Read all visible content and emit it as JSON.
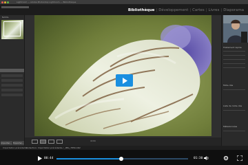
{
  "window": {
    "title": "Lightroom — Adobe Photoshop Lightroom — Bibliothèque"
  },
  "modules": [
    "Bibliothèque",
    "Développement",
    "Cartes",
    "Livres",
    "Diaporama"
  ],
  "active_module": "Bibliothèque",
  "left_panel": {
    "navigator_label": "NAVIG.",
    "import_button": "Importer...",
    "export_button": "Exporter..."
  },
  "filmstrip": {
    "source": "Importation précédente",
    "path": "Collection: Importation précédente / _IMG_7856.CR2"
  },
  "right_panel": {
    "quick_develop": "Traitement rapide",
    "keywords": "Mots-clés",
    "keyword_list": "Liste de mots-clés",
    "metadata": "Métadonnées"
  },
  "player": {
    "current_time": "00:44",
    "total_time": "01:30",
    "progress": 0.49
  },
  "colors": {
    "accent": "#1a8fe0",
    "module_active": "#ffffff"
  },
  "icons": {
    "play": "play-icon",
    "volume": "volume-icon",
    "settings": "settings-icon",
    "fullscreen": "fullscreen-icon"
  }
}
